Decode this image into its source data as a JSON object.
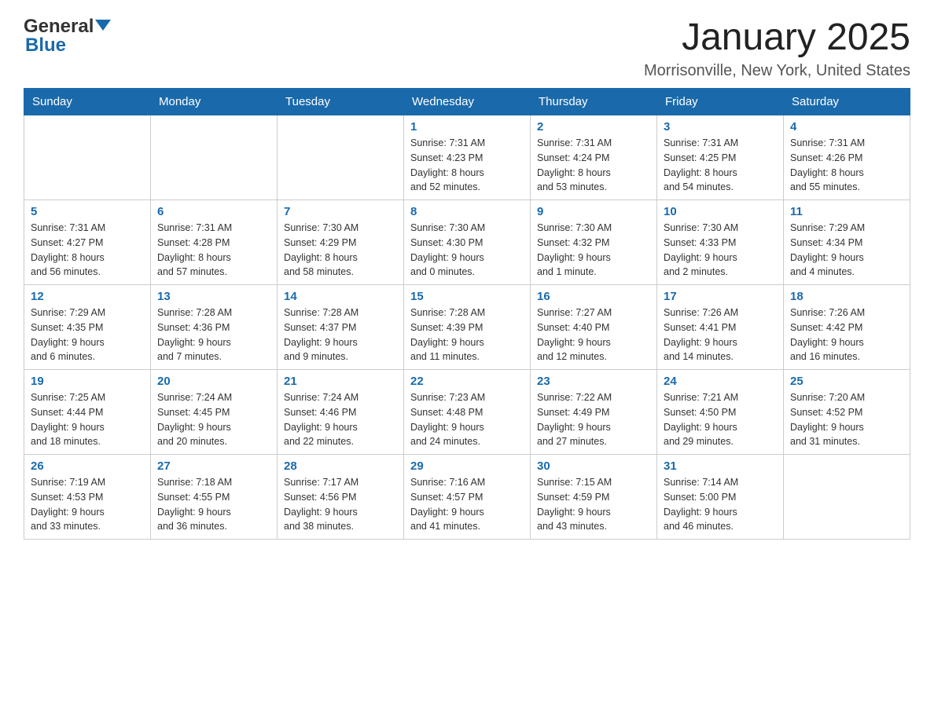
{
  "header": {
    "logo_general": "General",
    "logo_blue": "Blue",
    "month_title": "January 2025",
    "location": "Morrisonville, New York, United States"
  },
  "days_of_week": [
    "Sunday",
    "Monday",
    "Tuesday",
    "Wednesday",
    "Thursday",
    "Friday",
    "Saturday"
  ],
  "weeks": [
    [
      {
        "day": "",
        "info": ""
      },
      {
        "day": "",
        "info": ""
      },
      {
        "day": "",
        "info": ""
      },
      {
        "day": "1",
        "info": "Sunrise: 7:31 AM\nSunset: 4:23 PM\nDaylight: 8 hours\nand 52 minutes."
      },
      {
        "day": "2",
        "info": "Sunrise: 7:31 AM\nSunset: 4:24 PM\nDaylight: 8 hours\nand 53 minutes."
      },
      {
        "day": "3",
        "info": "Sunrise: 7:31 AM\nSunset: 4:25 PM\nDaylight: 8 hours\nand 54 minutes."
      },
      {
        "day": "4",
        "info": "Sunrise: 7:31 AM\nSunset: 4:26 PM\nDaylight: 8 hours\nand 55 minutes."
      }
    ],
    [
      {
        "day": "5",
        "info": "Sunrise: 7:31 AM\nSunset: 4:27 PM\nDaylight: 8 hours\nand 56 minutes."
      },
      {
        "day": "6",
        "info": "Sunrise: 7:31 AM\nSunset: 4:28 PM\nDaylight: 8 hours\nand 57 minutes."
      },
      {
        "day": "7",
        "info": "Sunrise: 7:30 AM\nSunset: 4:29 PM\nDaylight: 8 hours\nand 58 minutes."
      },
      {
        "day": "8",
        "info": "Sunrise: 7:30 AM\nSunset: 4:30 PM\nDaylight: 9 hours\nand 0 minutes."
      },
      {
        "day": "9",
        "info": "Sunrise: 7:30 AM\nSunset: 4:32 PM\nDaylight: 9 hours\nand 1 minute."
      },
      {
        "day": "10",
        "info": "Sunrise: 7:30 AM\nSunset: 4:33 PM\nDaylight: 9 hours\nand 2 minutes."
      },
      {
        "day": "11",
        "info": "Sunrise: 7:29 AM\nSunset: 4:34 PM\nDaylight: 9 hours\nand 4 minutes."
      }
    ],
    [
      {
        "day": "12",
        "info": "Sunrise: 7:29 AM\nSunset: 4:35 PM\nDaylight: 9 hours\nand 6 minutes."
      },
      {
        "day": "13",
        "info": "Sunrise: 7:28 AM\nSunset: 4:36 PM\nDaylight: 9 hours\nand 7 minutes."
      },
      {
        "day": "14",
        "info": "Sunrise: 7:28 AM\nSunset: 4:37 PM\nDaylight: 9 hours\nand 9 minutes."
      },
      {
        "day": "15",
        "info": "Sunrise: 7:28 AM\nSunset: 4:39 PM\nDaylight: 9 hours\nand 11 minutes."
      },
      {
        "day": "16",
        "info": "Sunrise: 7:27 AM\nSunset: 4:40 PM\nDaylight: 9 hours\nand 12 minutes."
      },
      {
        "day": "17",
        "info": "Sunrise: 7:26 AM\nSunset: 4:41 PM\nDaylight: 9 hours\nand 14 minutes."
      },
      {
        "day": "18",
        "info": "Sunrise: 7:26 AM\nSunset: 4:42 PM\nDaylight: 9 hours\nand 16 minutes."
      }
    ],
    [
      {
        "day": "19",
        "info": "Sunrise: 7:25 AM\nSunset: 4:44 PM\nDaylight: 9 hours\nand 18 minutes."
      },
      {
        "day": "20",
        "info": "Sunrise: 7:24 AM\nSunset: 4:45 PM\nDaylight: 9 hours\nand 20 minutes."
      },
      {
        "day": "21",
        "info": "Sunrise: 7:24 AM\nSunset: 4:46 PM\nDaylight: 9 hours\nand 22 minutes."
      },
      {
        "day": "22",
        "info": "Sunrise: 7:23 AM\nSunset: 4:48 PM\nDaylight: 9 hours\nand 24 minutes."
      },
      {
        "day": "23",
        "info": "Sunrise: 7:22 AM\nSunset: 4:49 PM\nDaylight: 9 hours\nand 27 minutes."
      },
      {
        "day": "24",
        "info": "Sunrise: 7:21 AM\nSunset: 4:50 PM\nDaylight: 9 hours\nand 29 minutes."
      },
      {
        "day": "25",
        "info": "Sunrise: 7:20 AM\nSunset: 4:52 PM\nDaylight: 9 hours\nand 31 minutes."
      }
    ],
    [
      {
        "day": "26",
        "info": "Sunrise: 7:19 AM\nSunset: 4:53 PM\nDaylight: 9 hours\nand 33 minutes."
      },
      {
        "day": "27",
        "info": "Sunrise: 7:18 AM\nSunset: 4:55 PM\nDaylight: 9 hours\nand 36 minutes."
      },
      {
        "day": "28",
        "info": "Sunrise: 7:17 AM\nSunset: 4:56 PM\nDaylight: 9 hours\nand 38 minutes."
      },
      {
        "day": "29",
        "info": "Sunrise: 7:16 AM\nSunset: 4:57 PM\nDaylight: 9 hours\nand 41 minutes."
      },
      {
        "day": "30",
        "info": "Sunrise: 7:15 AM\nSunset: 4:59 PM\nDaylight: 9 hours\nand 43 minutes."
      },
      {
        "day": "31",
        "info": "Sunrise: 7:14 AM\nSunset: 5:00 PM\nDaylight: 9 hours\nand 46 minutes."
      },
      {
        "day": "",
        "info": ""
      }
    ]
  ]
}
